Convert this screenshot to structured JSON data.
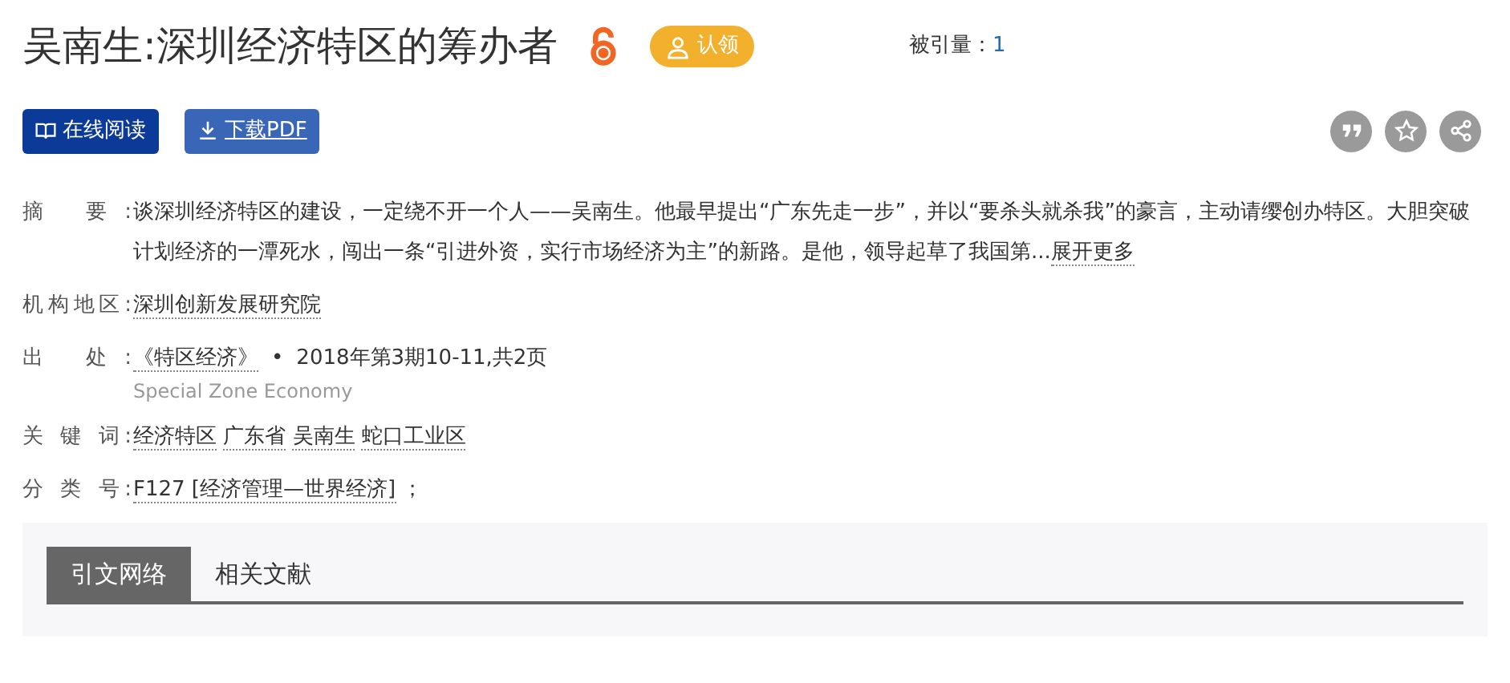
{
  "title": "吴南生:深圳经济特区的筹办者",
  "claim_button": "认领",
  "citations": {
    "label": "被引量：",
    "value": "1"
  },
  "actions": [
    {
      "kind": "read",
      "label": "在线阅读"
    },
    {
      "kind": "download",
      "label": "下载PDF"
    }
  ],
  "fields": [
    {
      "kind": "abstract",
      "label": "摘 要:",
      "text": "谈深圳经济特区的建设，一定绕不开一个人——吴南生。他最早提出“广东先走一步”，并以“要杀头就杀我”的豪言，主动请缨创办特区。大胆突破计划经济的一潭死水，闯出一条“引进外资，实行市场经济为主”的新路。是他，领导起草了我国第...",
      "more": "展开更多"
    },
    {
      "kind": "links",
      "label": "机构地区:",
      "links": [
        "深圳创新发展研究院"
      ]
    },
    {
      "kind": "source",
      "label": "出 处:",
      "journal": "《特区经济》",
      "separator": "•",
      "issue": "2018年第3期10-11,共2页",
      "english": "Special Zone Economy"
    },
    {
      "kind": "links",
      "label": "关 键 词:",
      "links": [
        "经济特区",
        "广东省",
        "吴南生",
        "蛇口工业区"
      ]
    },
    {
      "kind": "links",
      "label": "分 类 号:",
      "links": [
        "F127 [经济管理—世界经济]"
      ],
      "suffix": "；"
    }
  ],
  "tabs": [
    {
      "label": "引文网络",
      "selected": true
    },
    {
      "label": "相关文献",
      "selected": false
    }
  ]
}
